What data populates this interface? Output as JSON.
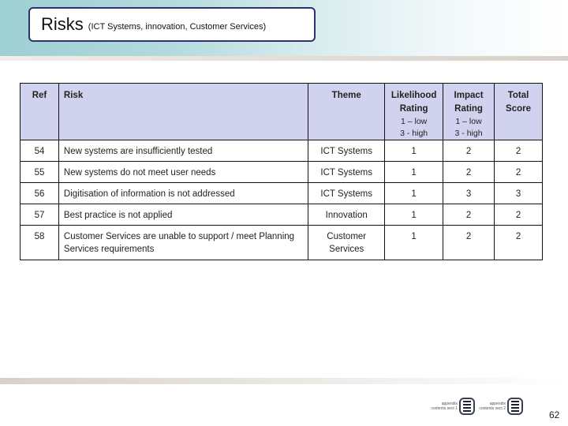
{
  "slide": {
    "title": "Risks",
    "subtitle": "(ICT Systems, innovation, Customer Services)",
    "page_number": "62"
  },
  "table": {
    "headers": {
      "ref": "Ref",
      "risk": "Risk",
      "theme": "Theme",
      "likelihood": "Likelihood Rating",
      "likelihood_scale_low": "1 – low",
      "likelihood_scale_high": "3 - high",
      "impact": "Impact Rating",
      "impact_scale_low": "1 – low",
      "impact_scale_high": "3 - high",
      "total": "Total Score"
    },
    "rows": [
      {
        "ref": "54",
        "risk": "New systems are insufficiently tested",
        "theme": "ICT Systems",
        "likelihood": "1",
        "impact": "2",
        "total": "2"
      },
      {
        "ref": "55",
        "risk": "New systems do not meet user needs",
        "theme": "ICT Systems",
        "likelihood": "1",
        "impact": "2",
        "total": "2"
      },
      {
        "ref": "56",
        "risk": "Digitisation of information is not addressed",
        "theme": "ICT Systems",
        "likelihood": "1",
        "impact": "3",
        "total": "3"
      },
      {
        "ref": "57",
        "risk": "Best practice is not applied",
        "theme": "Innovation",
        "likelihood": "1",
        "impact": "2",
        "total": "2"
      },
      {
        "ref": "58",
        "risk": "Customer Services are unable to support  / meet Planning Services  requirements",
        "theme": "Customer Services",
        "likelihood": "1",
        "impact": "2",
        "total": "2"
      }
    ]
  },
  "footer": {
    "nav_buttons": [
      {
        "label": "appendix contents sect 1",
        "icon": "list-icon"
      },
      {
        "label": "appendix contents sect 2",
        "icon": "list-icon"
      }
    ]
  },
  "colors": {
    "header_band": "#9dcfd3",
    "title_border": "#2e3270",
    "table_header_bg": "#d1d3ee"
  }
}
